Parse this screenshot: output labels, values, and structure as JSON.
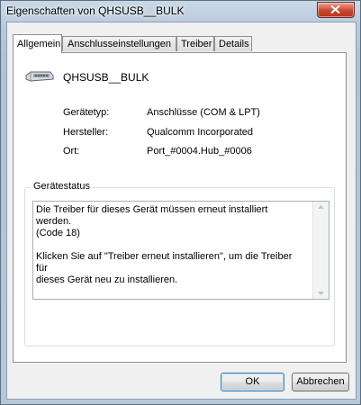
{
  "window": {
    "title": "Eigenschaften von QHSUSB__BULK",
    "close_icon": "close-icon"
  },
  "tabs": [
    {
      "label": "Allgemein",
      "active": true
    },
    {
      "label": "Anschlusseinstellungen",
      "active": false
    },
    {
      "label": "Treiber",
      "active": false
    },
    {
      "label": "Details",
      "active": false
    }
  ],
  "device": {
    "icon": "usb-connector-icon",
    "name": "QHSUSB__BULK",
    "properties": [
      {
        "label": "Gerätetyp:",
        "value": "Anschlüsse (COM & LPT)"
      },
      {
        "label": "Hersteller:",
        "value": "Qualcomm Incorporated"
      },
      {
        "label": "Ort:",
        "value": "Port_#0004.Hub_#0006"
      }
    ]
  },
  "status": {
    "title": "Gerätestatus",
    "text": "Die Treiber für dieses Gerät müssen erneut installiert werden.\n(Code 18)\n\nKlicken Sie auf \"Treiber erneut installieren\", um die Treiber für\ndieses Gerät neu zu installieren."
  },
  "buttons": {
    "ok": "OK",
    "cancel": "Abbrechen"
  }
}
